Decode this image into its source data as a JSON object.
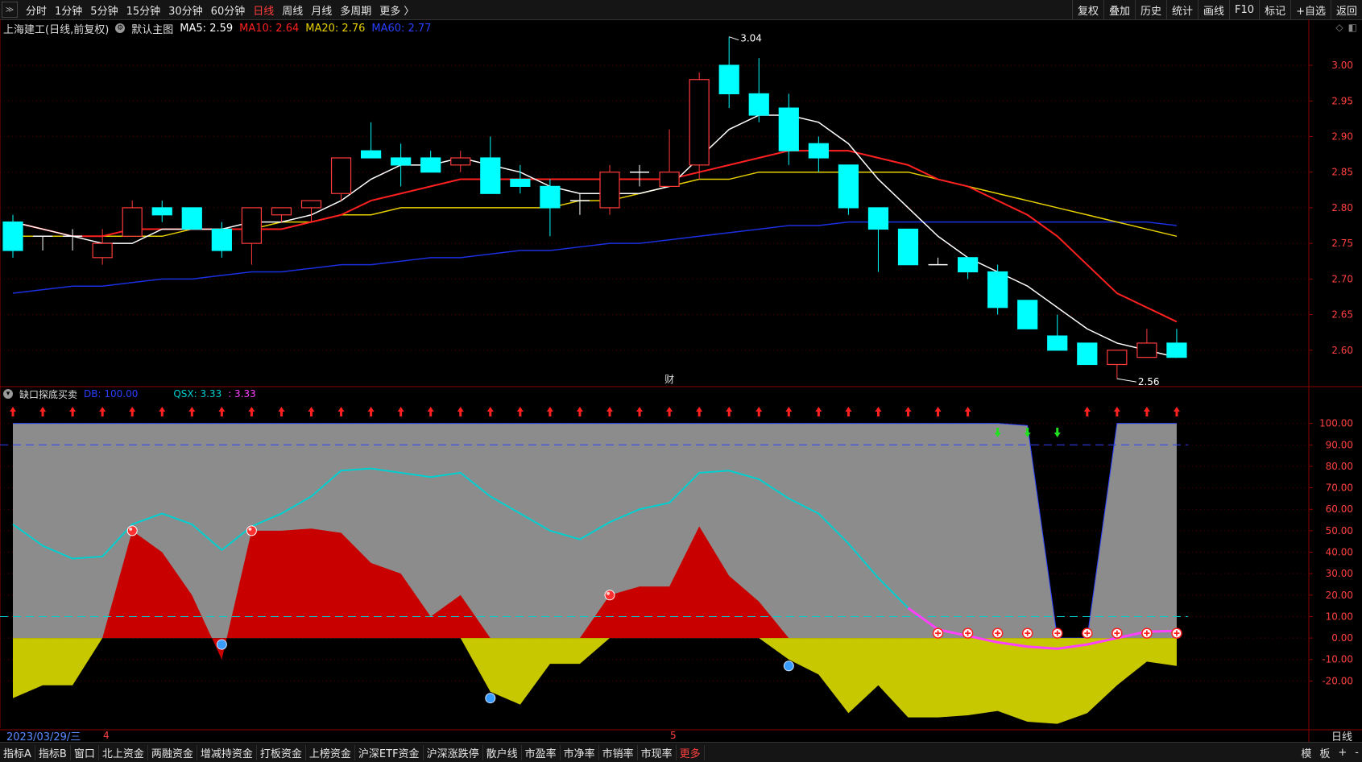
{
  "topbar": {
    "corner_icon": "collapse-icon",
    "periods": [
      "分时",
      "1分钟",
      "5分钟",
      "15分钟",
      "30分钟",
      "60分钟",
      "日线",
      "周线",
      "月线",
      "多周期",
      "更多 〉"
    ],
    "active_period": "日线",
    "right_buttons": [
      "复权",
      "叠加",
      "历史",
      "统计",
      "画线",
      "F10",
      "标记",
      "+自选",
      "返回"
    ]
  },
  "main_info": {
    "title": "上海建工(日线,前复权)",
    "template": "默认主图",
    "ma5_label": "MA5: 2.59",
    "ma10_label": "MA10: 2.64",
    "ma20_label": "MA20: 2.76",
    "ma60_label": "MA60: 2.77"
  },
  "sub_info": {
    "title": "缺口探底买卖",
    "db_label": "DB: 100.00",
    "qsx_label": "QSX: 3.33",
    "qsx_value": ": 3.33"
  },
  "annotations": {
    "high": "3.04",
    "low": "2.56",
    "fin_marker": "财",
    "month_4": "4",
    "month_5": "5"
  },
  "date_label": "2023/03/29/三",
  "freq_label": "日线",
  "bottombar": {
    "tabs": [
      "指标A",
      "指标B",
      "窗口",
      "北上资金",
      "两融资金",
      "增减持资金",
      "打板资金",
      "上榜资金",
      "沪深ETF资金",
      "沪深涨跌停",
      "散户线",
      "市盈率",
      "市净率",
      "市销率",
      "市现率",
      "更多"
    ],
    "right": [
      "模",
      "板",
      "+",
      "-"
    ]
  },
  "colors": {
    "up": "#ff3b3b",
    "down": "#00ffff",
    "ma5": "#ffffff",
    "ma10": "#ff2020",
    "ma20": "#e6d000",
    "ma60": "#1a2fe0",
    "grey": "#8c8c8c",
    "red_fill": "#c80000",
    "yellow_fill": "#c8c800",
    "qsx": "#00d0d0",
    "magenta": "#ff40ff"
  },
  "chart_data": [
    {
      "type": "candlestick",
      "title": "上海建工(日线,前复权)",
      "ylim": [
        2.55,
        3.06
      ],
      "yticks": [
        2.6,
        2.65,
        2.7,
        2.75,
        2.8,
        2.85,
        2.9,
        2.95,
        3.0
      ],
      "candles": [
        [
          2.78,
          2.79,
          2.73,
          2.74
        ],
        [
          2.76,
          2.76,
          2.74,
          2.76
        ],
        [
          2.76,
          2.77,
          2.74,
          2.76
        ],
        [
          2.73,
          2.77,
          2.72,
          2.75
        ],
        [
          2.76,
          2.81,
          2.76,
          2.8
        ],
        [
          2.8,
          2.81,
          2.78,
          2.79
        ],
        [
          2.8,
          2.8,
          2.77,
          2.77
        ],
        [
          2.77,
          2.78,
          2.73,
          2.74
        ],
        [
          2.75,
          2.8,
          2.72,
          2.8
        ],
        [
          2.79,
          2.8,
          2.78,
          2.8
        ],
        [
          2.8,
          2.81,
          2.78,
          2.81
        ],
        [
          2.82,
          2.87,
          2.81,
          2.87
        ],
        [
          2.88,
          2.92,
          2.87,
          2.87
        ],
        [
          2.87,
          2.89,
          2.83,
          2.86
        ],
        [
          2.87,
          2.88,
          2.85,
          2.85
        ],
        [
          2.86,
          2.88,
          2.85,
          2.87
        ],
        [
          2.87,
          2.9,
          2.82,
          2.82
        ],
        [
          2.84,
          2.86,
          2.82,
          2.83
        ],
        [
          2.83,
          2.84,
          2.76,
          2.8
        ],
        [
          2.81,
          2.82,
          2.79,
          2.81
        ],
        [
          2.8,
          2.86,
          2.79,
          2.85
        ],
        [
          2.85,
          2.86,
          2.83,
          2.85
        ],
        [
          2.83,
          2.91,
          2.83,
          2.85
        ],
        [
          2.86,
          2.99,
          2.84,
          2.98
        ],
        [
          3.0,
          3.04,
          2.94,
          2.96
        ],
        [
          2.96,
          3.01,
          2.92,
          2.93
        ],
        [
          2.94,
          2.96,
          2.86,
          2.88
        ],
        [
          2.89,
          2.9,
          2.85,
          2.87
        ],
        [
          2.86,
          2.86,
          2.79,
          2.8
        ],
        [
          2.8,
          2.8,
          2.71,
          2.77
        ],
        [
          2.77,
          2.77,
          2.72,
          2.72
        ],
        [
          2.72,
          2.73,
          2.72,
          2.72
        ],
        [
          2.73,
          2.73,
          2.7,
          2.71
        ],
        [
          2.71,
          2.72,
          2.65,
          2.66
        ],
        [
          2.67,
          2.67,
          2.63,
          2.63
        ],
        [
          2.62,
          2.65,
          2.6,
          2.6
        ],
        [
          2.61,
          2.61,
          2.58,
          2.58
        ],
        [
          2.58,
          2.6,
          2.56,
          2.6
        ],
        [
          2.59,
          2.63,
          2.59,
          2.61
        ],
        [
          2.61,
          2.63,
          2.59,
          2.59
        ]
      ],
      "ma5": [
        2.78,
        2.77,
        2.76,
        2.75,
        2.75,
        2.77,
        2.77,
        2.77,
        2.78,
        2.78,
        2.79,
        2.81,
        2.84,
        2.86,
        2.86,
        2.87,
        2.86,
        2.85,
        2.83,
        2.82,
        2.82,
        2.82,
        2.83,
        2.87,
        2.91,
        2.93,
        2.93,
        2.92,
        2.89,
        2.84,
        2.8,
        2.76,
        2.73,
        2.71,
        2.69,
        2.66,
        2.63,
        2.61,
        2.6,
        2.59
      ],
      "ma10": [
        2.78,
        2.77,
        2.76,
        2.76,
        2.77,
        2.77,
        2.77,
        2.77,
        2.77,
        2.77,
        2.78,
        2.79,
        2.81,
        2.82,
        2.83,
        2.84,
        2.84,
        2.84,
        2.84,
        2.84,
        2.84,
        2.84,
        2.84,
        2.85,
        2.86,
        2.87,
        2.88,
        2.88,
        2.88,
        2.87,
        2.86,
        2.84,
        2.83,
        2.81,
        2.79,
        2.76,
        2.72,
        2.68,
        2.66,
        2.64
      ],
      "ma20": [
        2.76,
        2.76,
        2.76,
        2.76,
        2.76,
        2.76,
        2.77,
        2.77,
        2.77,
        2.78,
        2.78,
        2.79,
        2.79,
        2.8,
        2.8,
        2.8,
        2.8,
        2.8,
        2.8,
        2.81,
        2.81,
        2.82,
        2.83,
        2.84,
        2.84,
        2.85,
        2.85,
        2.85,
        2.85,
        2.85,
        2.85,
        2.84,
        2.83,
        2.82,
        2.81,
        2.8,
        2.79,
        2.78,
        2.77,
        2.76
      ],
      "ma60": [
        2.68,
        2.685,
        2.69,
        2.69,
        2.695,
        2.7,
        2.7,
        2.705,
        2.71,
        2.71,
        2.715,
        2.72,
        2.72,
        2.725,
        2.73,
        2.73,
        2.735,
        2.74,
        2.74,
        2.745,
        2.75,
        2.75,
        2.755,
        2.76,
        2.765,
        2.77,
        2.775,
        2.775,
        2.78,
        2.78,
        2.78,
        2.78,
        2.78,
        2.78,
        2.78,
        2.78,
        2.78,
        2.78,
        2.78,
        2.775
      ]
    },
    {
      "type": "area",
      "title": "缺口探底买卖",
      "ylim": [
        -42,
        110
      ],
      "yticks": [
        100,
        90,
        80,
        70,
        60,
        50,
        40,
        30,
        20,
        10,
        0,
        -10,
        -20
      ],
      "db": [
        100,
        100,
        100,
        100,
        100,
        100,
        100,
        100,
        100,
        100,
        100,
        100,
        100,
        100,
        100,
        100,
        100,
        100,
        100,
        100,
        100,
        100,
        100,
        100,
        100,
        100,
        100,
        100,
        100,
        100,
        100,
        100,
        100,
        100,
        99,
        0,
        0,
        100,
        100,
        100
      ],
      "qsx": [
        53,
        43,
        37,
        38,
        53,
        58,
        53,
        41,
        52,
        58,
        66,
        78,
        79,
        77,
        75,
        77,
        66,
        58,
        50,
        46,
        54,
        60,
        63,
        77,
        78,
        74,
        65,
        58,
        44,
        28,
        14,
        4,
        1,
        -2,
        -4,
        -5,
        -3,
        0,
        3,
        3.33
      ],
      "red": [
        0,
        0,
        0,
        0,
        50,
        40,
        20,
        -10,
        50,
        50,
        51,
        49,
        35,
        30,
        10,
        20,
        0,
        0,
        0,
        0,
        20,
        24,
        24,
        52,
        29,
        17,
        0,
        0,
        0,
        0,
        0,
        0,
        0,
        0,
        0,
        0,
        0,
        0,
        0,
        0
      ],
      "yellow": [
        -28,
        -22,
        -22,
        0,
        0,
        0,
        0,
        0,
        0,
        0,
        0,
        0,
        0,
        0,
        0,
        0,
        -25,
        -31,
        -12,
        -12,
        0,
        0,
        0,
        0,
        0,
        0,
        -10,
        -17,
        -35,
        -22,
        -37,
        -37,
        -36,
        -34,
        -39,
        -40,
        -35,
        -22,
        -11,
        -13
      ],
      "buy_markers": [
        31,
        32,
        33,
        34,
        35,
        36,
        37,
        38,
        39
      ],
      "red_ball_markers": [
        4,
        8,
        20
      ],
      "blue_ball_markers": [
        7,
        16,
        26
      ],
      "up_arrows": [
        0,
        1,
        2,
        3,
        4,
        5,
        6,
        7,
        8,
        9,
        10,
        11,
        12,
        13,
        14,
        15,
        16,
        17,
        18,
        19,
        20,
        21,
        22,
        23,
        24,
        25,
        26,
        27,
        28,
        29,
        30,
        31,
        32,
        36,
        37,
        38,
        39
      ],
      "down_arrows": [
        33,
        34,
        35
      ],
      "dash_levels": [
        90,
        10
      ]
    }
  ]
}
